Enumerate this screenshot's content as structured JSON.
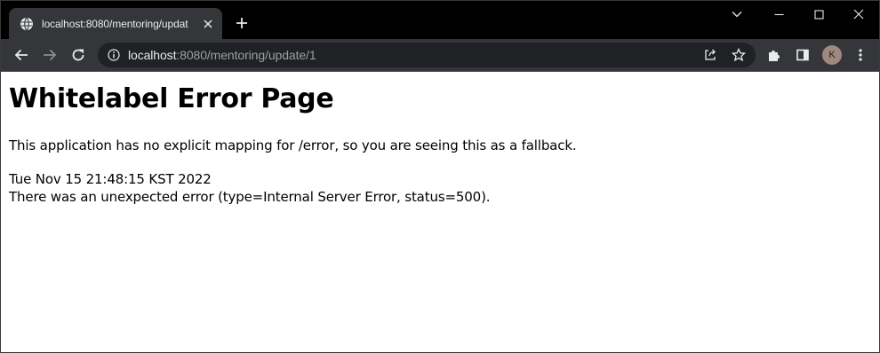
{
  "browser": {
    "tab_title": "localhost:8080/mentoring/updat",
    "url_host": "localhost",
    "url_rest": ":8080/mentoring/update/1",
    "avatar_initial": "K",
    "icons": {
      "favicon": "globe-icon",
      "tab_close": "close-icon",
      "new_tab": "plus-icon",
      "tab_search": "chevron-down-icon",
      "minimize": "minimize-icon",
      "maximize": "maximize-icon",
      "close_window": "close-icon",
      "back": "arrow-left-icon",
      "forward": "arrow-right-icon",
      "reload": "reload-icon",
      "site_info": "info-icon",
      "share": "share-icon",
      "bookmark": "star-icon",
      "extensions": "puzzle-icon",
      "side_panel": "side-panel-icon",
      "menu": "kebab-menu-icon"
    }
  },
  "page": {
    "heading": "Whitelabel Error Page",
    "message": "This application has no explicit mapping for /error, so you are seeing this as a fallback.",
    "timestamp": "Tue Nov 15 21:48:15 KST 2022",
    "error_detail": "There was an unexpected error (type=Internal Server Error, status=500)."
  },
  "colors": {
    "tab_bar": "#000000",
    "toolbar": "#35363a",
    "omnibox": "#202124",
    "avatar": "#a1887f"
  }
}
